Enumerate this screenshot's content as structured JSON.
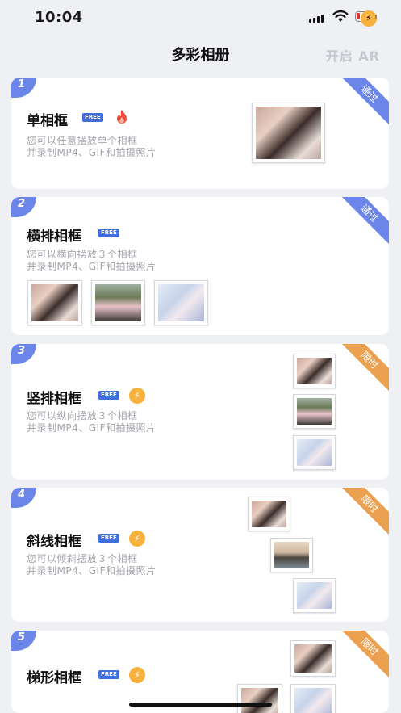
{
  "status_bar": {
    "time": "10:04"
  },
  "header": {
    "title": "多彩相册",
    "ar_button": "开启 AR"
  },
  "cards": [
    {
      "number": "1",
      "title": "单相框",
      "free_badge": "FREE",
      "ribbon": "通过",
      "ribbon_color": "#6b86e8",
      "desc_line1": "您可以任意摆放单个相框",
      "desc_line2": "并录制MP4、GIF和拍摄照片",
      "extra_icon": "fire-icon"
    },
    {
      "number": "2",
      "title": "横排相框",
      "free_badge": "FREE",
      "ribbon": "通过",
      "ribbon_color": "#6b86e8",
      "desc_line1": "您可以横向摆放３个相框",
      "desc_line2": "并录制MP4、GIF和拍摄照片"
    },
    {
      "number": "3",
      "title": "竖排相框",
      "free_badge": "FREE",
      "ribbon": "限时",
      "ribbon_color": "#eca150",
      "desc_line1": "您可以纵向摆放３个相框",
      "desc_line2": "并录制MP4、GIF和拍摄照片",
      "extra_icon": "lightning-icon"
    },
    {
      "number": "4",
      "title": "斜线相框",
      "free_badge": "FREE",
      "ribbon": "限时",
      "ribbon_color": "#eca150",
      "desc_line1": "您可以倾斜摆放３个相框",
      "desc_line2": "并录制MP4、GIF和拍摄照片",
      "extra_icon": "lightning-icon"
    },
    {
      "number": "5",
      "title": "梯形相框",
      "free_badge": "FREE",
      "ribbon": "限时",
      "ribbon_color": "#eca150",
      "extra_icon": "lightning-icon"
    }
  ]
}
